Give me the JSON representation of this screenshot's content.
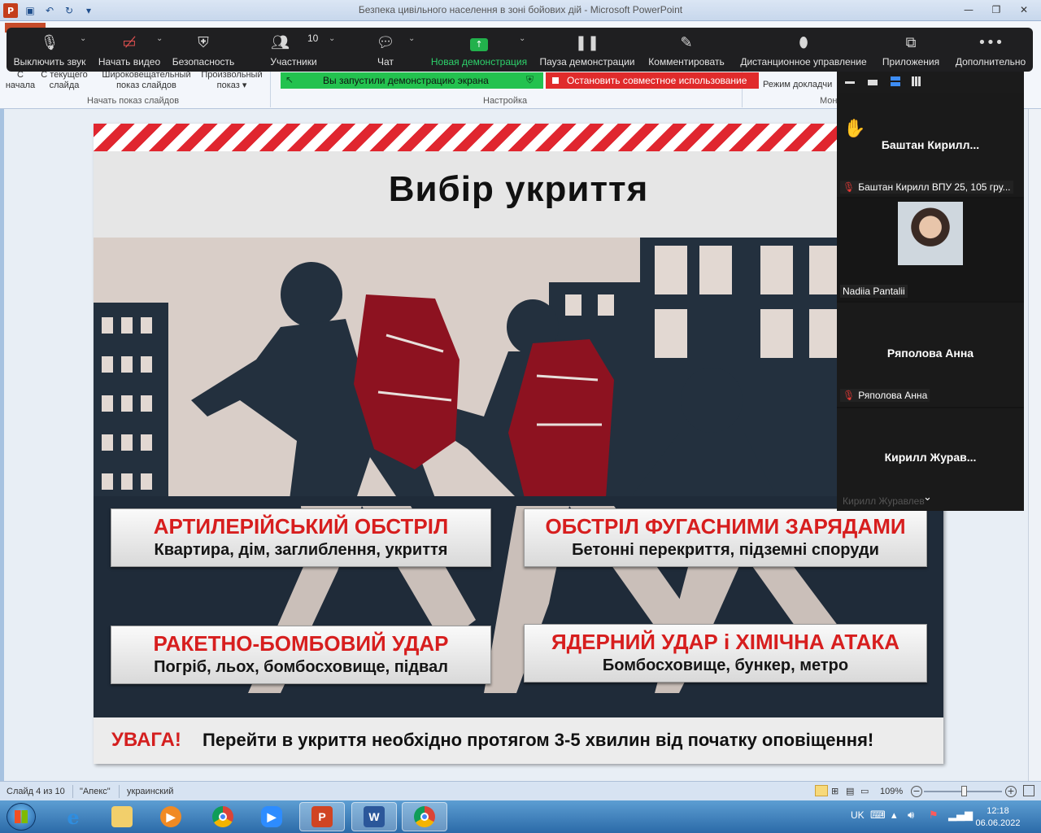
{
  "window": {
    "title": "Безпека цивільного населення в зоні бойових дій  -  Microsoft PowerPoint"
  },
  "ribbon": {
    "groups": [
      {
        "label_top": "С",
        "label_bottom": "начала"
      },
      {
        "label_top": "С текущего",
        "label_bottom": "слайда"
      },
      {
        "label_top": "Широковещательный",
        "label_bottom": "показ слайдов"
      },
      {
        "label_top": "Произвольный",
        "label_bottom": "показ ▾"
      }
    ],
    "group_label_start": "Начать показ слайдов",
    "group_label_setup": "Настройка",
    "presenter_mode": "Режим докладчи",
    "monitor_group": "Мон"
  },
  "zoom_toolbar": {
    "items": [
      {
        "label": "Выключить звук",
        "icon": "microphone-icon"
      },
      {
        "label": "Начать видео",
        "icon": "video-off-icon"
      },
      {
        "label": "Безопасность",
        "icon": "shield-icon"
      },
      {
        "label": "Участники",
        "icon": "participants-icon",
        "count": "10"
      },
      {
        "label": "Чат",
        "icon": "chat-icon"
      },
      {
        "label": "Новая демонстрация",
        "icon": "share-screen-icon"
      },
      {
        "label": "Пауза демонстрации",
        "icon": "pause-icon"
      },
      {
        "label": "Комментировать",
        "icon": "pencil-icon"
      },
      {
        "label": "Дистанционное управление",
        "icon": "mouse-icon"
      },
      {
        "label": "Приложения",
        "icon": "apps-icon"
      },
      {
        "label": "Дополнительно",
        "icon": "more-icon"
      }
    ],
    "share_banner": "Вы запустили демонстрацию экрана",
    "stop_banner": "Остановить совместное использование",
    "accent_green": "#23c24f",
    "accent_red": "#e02b2b"
  },
  "slide": {
    "title": "Вибір укриття",
    "cards": [
      {
        "heading": "АРТИЛЕРІЙСЬКИЙ ОБСТРІЛ",
        "sub": "Квартира, дім, заглиблення, укриття"
      },
      {
        "heading": "ОБСТРІЛ ФУГАСНИМИ ЗАРЯДАМИ",
        "sub": "Бетонні перекриття, підземні споруди"
      },
      {
        "heading": "РАКЕТНО-БОМБОВИЙ УДАР",
        "sub": "Погріб, льох, бомбосховище, підвал"
      },
      {
        "heading": "ЯДЕРНИЙ УДАР і ХІМІЧНА АТАКА",
        "sub": "Бомбосховище, бункер, метро"
      }
    ],
    "warning_label": "УВАГА!",
    "warning_text": "Перейти в укриття необхідно протягом 3-5 хвилин від початку оповіщення!",
    "heading_color": "#d71e1e"
  },
  "participants": [
    {
      "display_name": "Баштан  Кирилл...",
      "tag": "Баштан Кирилл ВПУ 25, 105 гру...",
      "muted": true,
      "raised_hand": true
    },
    {
      "display_name": "",
      "tag": "Nadiia Pantalii",
      "muted": false,
      "has_video": true
    },
    {
      "display_name": "Ряполова Анна",
      "tag": "Ряполова Анна",
      "muted": true
    },
    {
      "display_name": "Кирилл  Журав...",
      "tag": "Кирилл Журавлев",
      "muted": false
    }
  ],
  "statusbar": {
    "slide_info": "Слайд 4 из 10",
    "theme": "\"Апекс\"",
    "language": "украинский",
    "zoom": "109%",
    "zoom_level_percent": 109
  },
  "taskbar": {
    "apps": [
      {
        "name": "internet-explorer",
        "active": false
      },
      {
        "name": "file-explorer",
        "active": false
      },
      {
        "name": "media-player",
        "active": false
      },
      {
        "name": "chrome",
        "active": false
      },
      {
        "name": "zoom",
        "active": false
      },
      {
        "name": "powerpoint",
        "active": true
      },
      {
        "name": "word",
        "active": true
      },
      {
        "name": "chrome-profile",
        "active": true
      }
    ],
    "language": "UK",
    "time": "12:18",
    "date": "06.06.2022"
  }
}
